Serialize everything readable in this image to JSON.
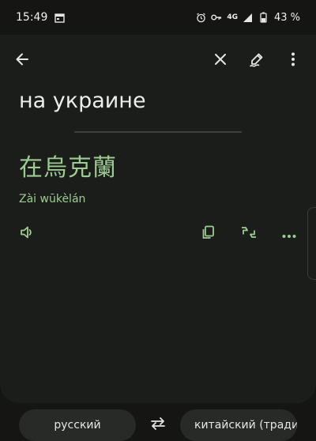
{
  "status": {
    "time": "15:49",
    "network": "4G",
    "battery": "43 %",
    "icons": [
      "calendar-icon",
      "alarm-icon",
      "key-icon",
      "signal-icon",
      "battery-icon"
    ]
  },
  "toolbar": {
    "back_icon": "arrow-left-icon",
    "close_icon": "close-icon",
    "handwrite_icon": "handwriting-icon",
    "more_icon": "more-vert-icon"
  },
  "translation": {
    "source_text": "на украине",
    "result_text": "在烏克蘭",
    "romanization": "Zài wūkèlán"
  },
  "actions": {
    "icons": [
      "speaker-icon",
      "copy-icon",
      "feedback-icon",
      "more-horiz-icon"
    ]
  },
  "language_bar": {
    "source_lang": "русский",
    "target_lang": "китайский (традиционный)",
    "swap_icon": "swap-icon"
  },
  "colors": {
    "background": "#151513",
    "card": "#1b1d1a",
    "accent_green": "#9ecb92",
    "pill": "#272a26"
  }
}
